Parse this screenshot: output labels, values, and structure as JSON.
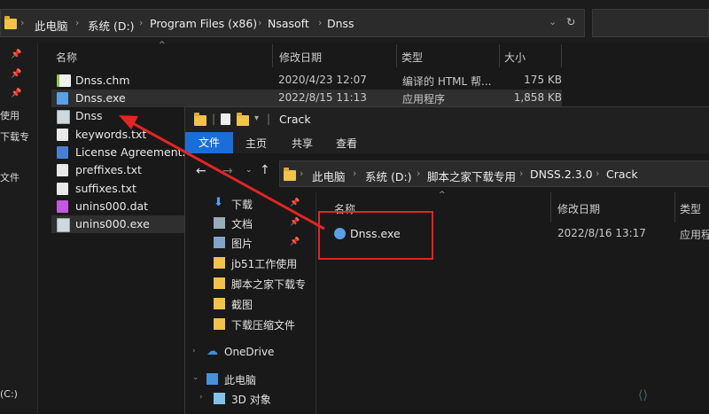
{
  "back": {
    "breadcrumb": [
      "此电脑",
      "系统 (D:)",
      "Program Files (x86)",
      "Nsasoft",
      "Dnss"
    ],
    "columns": {
      "name": "名称",
      "date": "修改日期",
      "type": "类型",
      "size": "大小"
    },
    "nav_fragments": [
      "使用",
      "下载专",
      "文件"
    ],
    "drive_fragment": "(C:)",
    "files": [
      {
        "name": "Dnss.chm",
        "date": "2020/4/23 12:07",
        "type": "编译的 HTML 帮...",
        "size": "175 KB",
        "icon": "chm-icon"
      },
      {
        "name": "Dnss.exe",
        "date": "2022/8/15 11:13",
        "type": "应用程序",
        "size": "1,858 KB",
        "icon": "exe-icon"
      },
      {
        "name": "Dnss",
        "date": "",
        "type": "",
        "size": "",
        "icon": "app-icon"
      },
      {
        "name": "keywords.txt",
        "date": "",
        "type": "",
        "size": "",
        "icon": "doc-icon"
      },
      {
        "name": "License Agreement.rtf",
        "date": "",
        "type": "",
        "size": "",
        "icon": "license-icon"
      },
      {
        "name": "preffixes.txt",
        "date": "",
        "type": "",
        "size": "",
        "icon": "doc-icon"
      },
      {
        "name": "suffixes.txt",
        "date": "",
        "type": "",
        "size": "",
        "icon": "doc-icon"
      },
      {
        "name": "unins000.dat",
        "date": "",
        "type": "",
        "size": "",
        "icon": "dat-icon"
      },
      {
        "name": "unins000.exe",
        "date": "",
        "type": "",
        "size": "",
        "icon": "app-icon"
      }
    ]
  },
  "front": {
    "title": "Crack",
    "ribbon": {
      "file": "文件",
      "home": "主页",
      "share": "共享",
      "view": "查看"
    },
    "breadcrumb": [
      "此电脑",
      "系统 (D:)",
      "脚本之家下载专用",
      "DNSS.2.3.0",
      "Crack"
    ],
    "nav": [
      {
        "label": "下载",
        "icon": "download-icon",
        "pinned": true
      },
      {
        "label": "文档",
        "icon": "document-icon",
        "pinned": true
      },
      {
        "label": "图片",
        "icon": "picture-icon",
        "pinned": true
      },
      {
        "label": "jb51工作使用",
        "icon": "folder-icon",
        "pinned": false
      },
      {
        "label": "脚本之家下载专",
        "icon": "folder-icon",
        "pinned": false
      },
      {
        "label": "截图",
        "icon": "folder-icon",
        "pinned": false
      },
      {
        "label": "下载压缩文件",
        "icon": "folder-icon",
        "pinned": false
      },
      {
        "label": "OneDrive",
        "icon": "cloud-icon",
        "pinned": false
      },
      {
        "label": "此电脑",
        "icon": "computer-icon",
        "pinned": false
      },
      {
        "label": "3D 对象",
        "icon": "cube-icon",
        "pinned": false
      }
    ],
    "columns": {
      "name": "名称",
      "date": "修改日期",
      "type": "类型"
    },
    "files": [
      {
        "name": "Dnss.exe",
        "date": "2022/8/16 13:17",
        "type": "应用程序"
      }
    ]
  },
  "colors": {
    "annotation": "#e02525",
    "accent": "#1b6ed8",
    "folder": "#f2c24a"
  }
}
